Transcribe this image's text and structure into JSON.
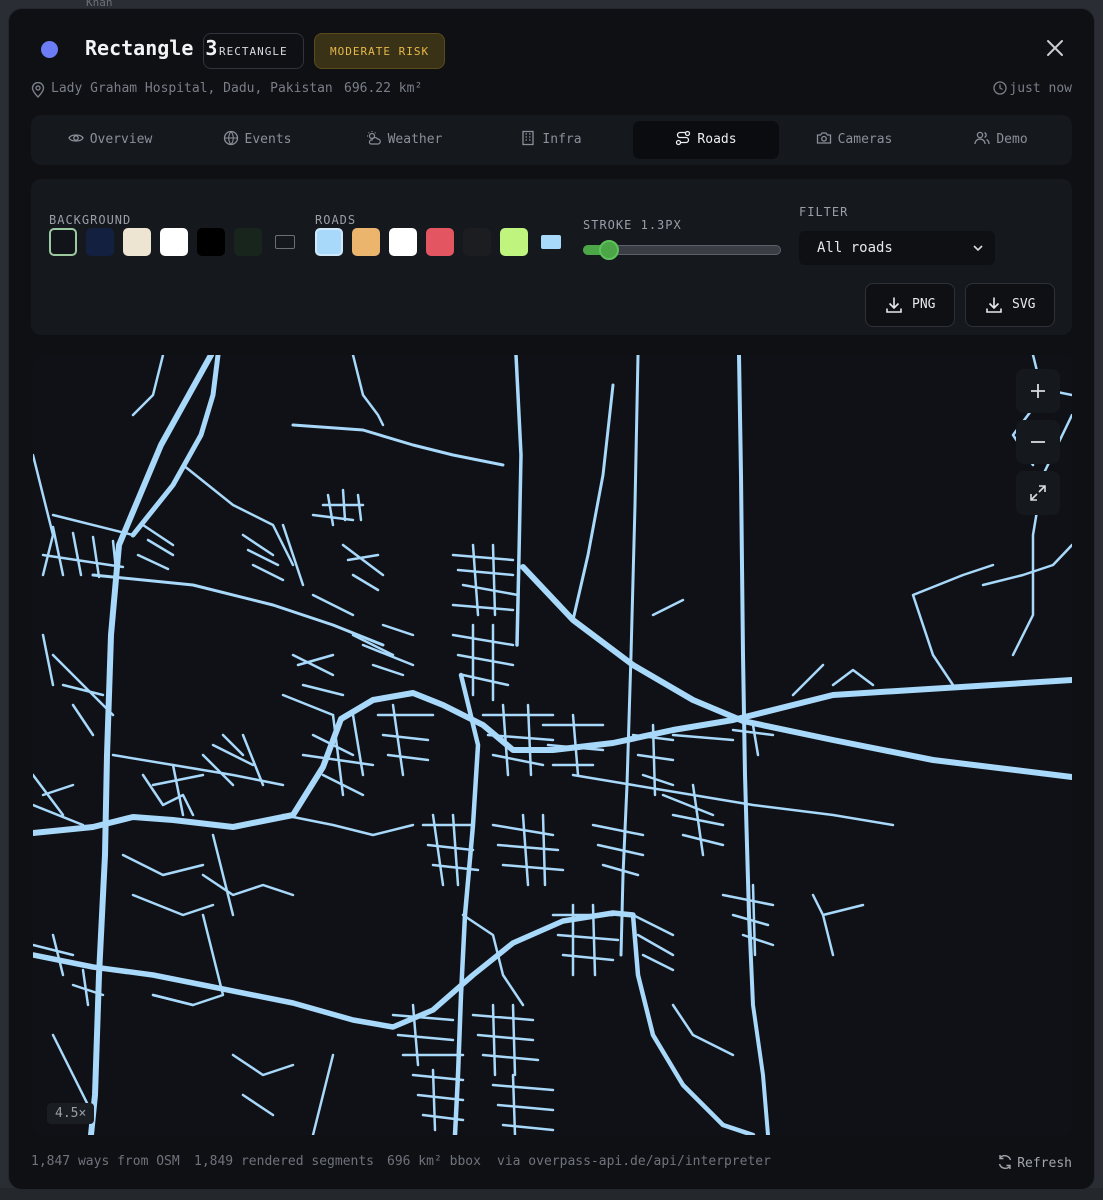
{
  "header": {
    "title": "Rectangle 3",
    "shape_chip": "RECTANGLE",
    "risk_chip": "MODERATE RISK",
    "location": "Lady Graham Hospital, Dadu, Pakistan",
    "area": "696.22 km²",
    "updated": "just now",
    "accent_color": "#6b7cf5",
    "risk_color": "#e6b94a"
  },
  "tabs": [
    {
      "label": "Overview",
      "icon": "eye-icon"
    },
    {
      "label": "Events",
      "icon": "globe-icon"
    },
    {
      "label": "Weather",
      "icon": "sun-cloud-icon"
    },
    {
      "label": "Infra",
      "icon": "building-icon"
    },
    {
      "label": "Roads",
      "icon": "route-icon",
      "active": true
    },
    {
      "label": "Cameras",
      "icon": "camera-icon"
    },
    {
      "label": "Demo",
      "icon": "users-icon"
    }
  ],
  "controls": {
    "background_label": "BACKGROUND",
    "background_swatches": [
      "#11151a",
      "#14203f",
      "#ede4d2",
      "#ffffff",
      "#000000",
      "#17251c",
      "transparent"
    ],
    "roads_label": "ROADS",
    "road_swatches": [
      "#a8d8fa",
      "#ecb56e",
      "#ffffff",
      "#e25561",
      "#1b1d20",
      "#bff57e",
      "#a8d8fa"
    ],
    "stroke_label": "STROKE",
    "stroke_value": "1.3PX",
    "stroke_fraction": 0.08,
    "filter_label": "FILTER",
    "filter_value": "All roads",
    "png_label": "PNG",
    "svg_label": "SVG"
  },
  "map": {
    "road_color": "#a8d8fa",
    "zoom_level": "4.5×"
  },
  "footer": {
    "ways": "1,847 ways from OSM",
    "segments": "1,849 rendered segments",
    "bbox": "696 km² bbox",
    "source": "via overpass-api.de/api/interpreter",
    "refresh_label": "Refresh"
  }
}
